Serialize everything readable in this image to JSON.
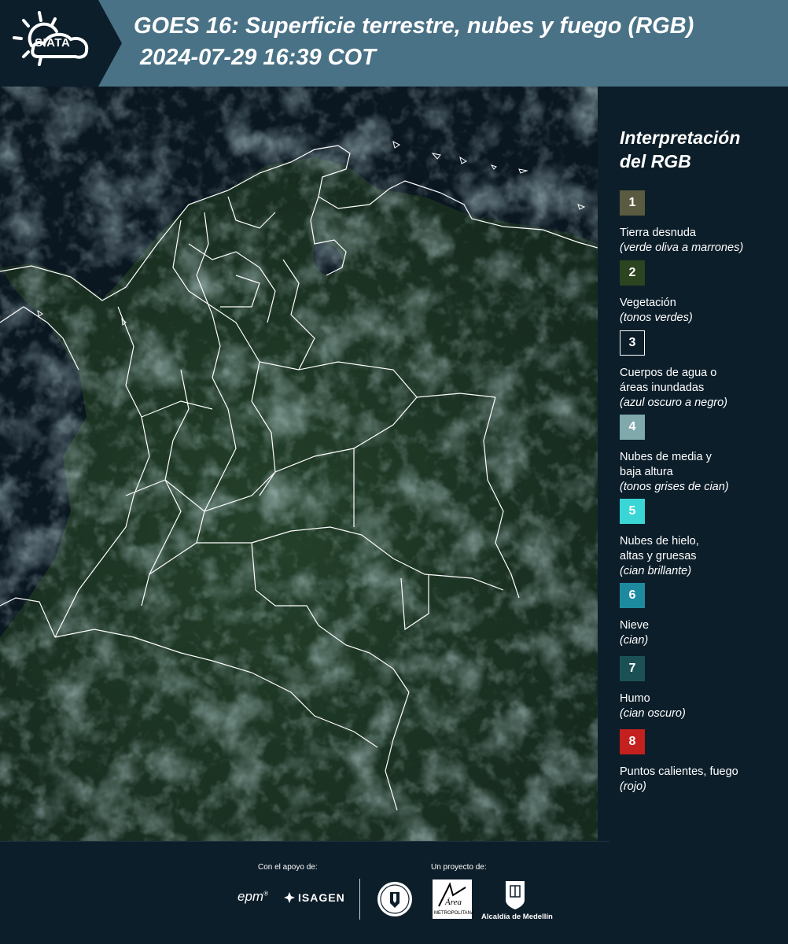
{
  "header": {
    "logo_text": "SIATA",
    "title": "GOES 16: Superficie terrestre, nubes y fuego (RGB)",
    "subtitle": "2024-07-29 16:39 COT",
    "bg_color": "#4a7286"
  },
  "map": {
    "description_icon": "satellite-rgb-imagery",
    "land_color": "#1e3520",
    "ocean_color": "#0a1620",
    "cloud_color": "#7aa4aa",
    "border_color": "#ffffff"
  },
  "legend": {
    "title_line1": "Interpretación",
    "title_line2": "del RGB",
    "items": [
      {
        "number": "1",
        "label": "Tierra desnuda",
        "note": "(verde oliva a marrones)",
        "color": "#5a5a40"
      },
      {
        "number": "2",
        "label": "Vegetación",
        "note": "(tonos verdes)",
        "color": "#2c4420"
      },
      {
        "number": "3",
        "label": "Cuerpos de agua o",
        "label2": "áreas inundadas",
        "note": "(azul oscuro a negro)",
        "color": "#0c1e2a"
      },
      {
        "number": "4",
        "label": "Nubes de media y",
        "label2": "baja altura",
        "note": "(tonos grises de cian)",
        "color": "#7fa9ab"
      },
      {
        "number": "5",
        "label": "Nubes de hielo,",
        "label2": "altas y gruesas",
        "note": "(cian brillante)",
        "color": "#3ad5d5"
      },
      {
        "number": "6",
        "label": "Nieve",
        "note": "(cian)",
        "color": "#1d8aa0"
      },
      {
        "number": "7",
        "label": "Humo",
        "note": "(cian oscuro)",
        "color": "#1b5155"
      },
      {
        "number": "8",
        "label": "Puntos calientes, fuego",
        "note": "(rojo)",
        "color": "#c4201e"
      }
    ]
  },
  "footer": {
    "support_label": "Con el apoyo de:",
    "project_label": "Un proyecto de:",
    "epm": "epm",
    "epm_mark": "®",
    "isagen": "ISAGEN",
    "area": "Área",
    "area_sub": "METROPOLITANA",
    "alcaldia": "Alcaldía de Medellín"
  }
}
